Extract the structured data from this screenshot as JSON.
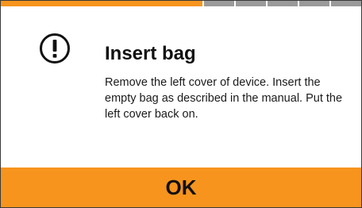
{
  "progress": {
    "total_steps": 6,
    "completed_fraction": 0.56,
    "active_color": "#f7941d",
    "inactive_color": "#9a9a9a"
  },
  "dialog": {
    "icon": "exclamation-circle-icon",
    "title": "Insert bag",
    "message": "Remove the left cover of device. Insert the empty bag as described in the manual. Put the left cover back on."
  },
  "ok_button": {
    "label": "OK",
    "color": "#f7941d"
  }
}
